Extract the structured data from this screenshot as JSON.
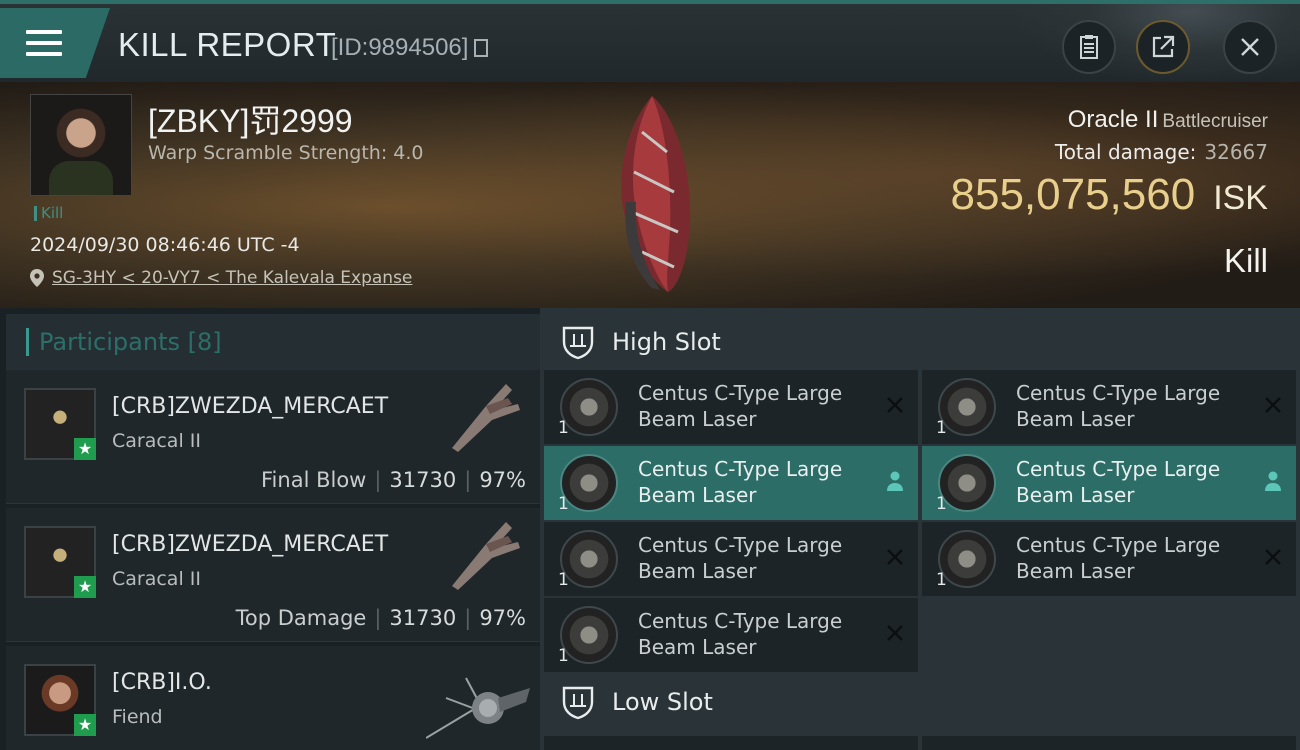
{
  "header": {
    "title": "KILL REPORT",
    "report_id": "[ID:9894506]"
  },
  "victim": {
    "name": "[ZBKY]罚2999",
    "warp_scramble": "Warp Scramble Strength: 4.0",
    "tag": "Kill",
    "datetime": "2024/09/30 08:46:46 UTC -4",
    "location": "SG-3HY < 20-VY7 < The Kalevala Expanse",
    "ship_name": "Oracle II",
    "ship_class": "Battlecruiser",
    "total_damage_label": "Total damage:",
    "total_damage": "32667",
    "isk_value": "855,075,560",
    "isk_unit": "ISK",
    "result": "Kill"
  },
  "participants": {
    "label": "Participants [8]",
    "rows": [
      {
        "name": "[CRB]ZWEZDA_MERCAET",
        "ship": "Caracal II",
        "stat_label": "Final Blow",
        "damage": "31730",
        "percent": "97%"
      },
      {
        "name": "[CRB]ZWEZDA_MERCAET",
        "ship": "Caracal II",
        "stat_label": "Top Damage",
        "damage": "31730",
        "percent": "97%"
      },
      {
        "name": "[CRB]I.O.",
        "ship": "Fiend",
        "stat_label": "",
        "damage": "",
        "percent": ""
      }
    ]
  },
  "slots": {
    "high_label": "High Slot",
    "low_label": "Low Slot",
    "high_modules": [
      {
        "line1": "Centus C-Type Large",
        "line2": "Beam Laser",
        "qty": "1",
        "status": "destroyed"
      },
      {
        "line1": "Centus C-Type Large",
        "line2": "Beam Laser",
        "qty": "1",
        "status": "destroyed"
      },
      {
        "line1": "Centus C-Type Large",
        "line2": "Beam Laser",
        "qty": "1",
        "status": "dropped"
      },
      {
        "line1": "Centus C-Type Large",
        "line2": "Beam Laser",
        "qty": "1",
        "status": "dropped"
      },
      {
        "line1": "Centus C-Type Large",
        "line2": "Beam Laser",
        "qty": "1",
        "status": "destroyed"
      },
      {
        "line1": "Centus C-Type Large",
        "line2": "Beam Laser",
        "qty": "1",
        "status": "destroyed"
      },
      {
        "line1": "Centus C-Type Large",
        "line2": "Beam Laser",
        "qty": "1",
        "status": "destroyed"
      }
    ]
  },
  "colors": {
    "accent": "#2d6d68",
    "isk": "#e8cf8c",
    "star_badge": "#1f9c4d"
  },
  "icons": [
    "menu-icon",
    "copy-icon",
    "clipboard-icon",
    "share-icon",
    "close-icon",
    "location-pin-icon",
    "shield-slot-icon",
    "destroyed-x-icon",
    "dropped-person-icon",
    "star-icon"
  ]
}
